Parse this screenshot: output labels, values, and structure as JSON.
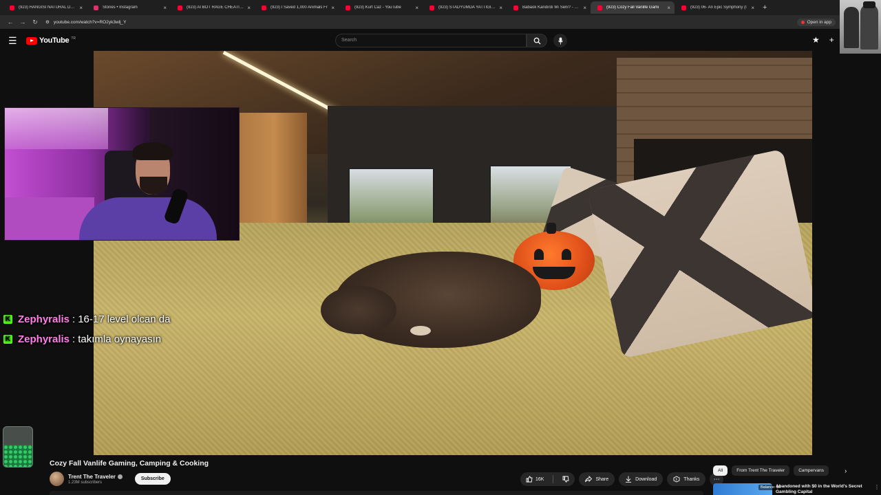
{
  "browser": {
    "tabs": [
      {
        "label": "(923) HANGİSİ NATURAL DEĞİ",
        "color": "#ff0033",
        "active": false
      },
      {
        "label": "Stories • Instagram",
        "color": "#e1306c",
        "active": false
      },
      {
        "label": "(923) AI BOT RAGE CHEATING",
        "color": "#ff0033",
        "active": false
      },
      {
        "label": "(923) I Saved 1,000 Animals Fr",
        "color": "#ff0033",
        "active": false
      },
      {
        "label": "(923) Kurt Caz - YouTube",
        "color": "#ff0033",
        "active": false
      },
      {
        "label": "(923) STADYUMDA YATTIĞIN Y",
        "color": "#ff0033",
        "active": false
      },
      {
        "label": "Babaok Kandırdı Mı Seni? - You",
        "color": "#ff0033",
        "active": false
      },
      {
        "label": "(923) Cozy Fall Vanlife Gami",
        "color": "#ff0033",
        "active": true
      },
      {
        "label": "(923) 06- An Epic Symphony (I",
        "color": "#ff0033",
        "active": false
      }
    ],
    "new_tab": "+",
    "url": "youtube.com/watch?v=RO2yk3wlj_Y",
    "open_in_app": "Open in app"
  },
  "youtube": {
    "logo_text": "YouTube",
    "logo_sup": "TR",
    "search_placeholder": "Search"
  },
  "chat": [
    {
      "user": "Zephyralis",
      "sep": ":",
      "message": "16-17 level olcan da"
    },
    {
      "user": "Zephyralis",
      "sep": ":",
      "message": "takımla oynayasın"
    }
  ],
  "video": {
    "title": "Cozy Fall Vanlife Gaming, Camping & Cooking",
    "channel": "Trent The Traveler",
    "subscribers": "1.23M subscribers",
    "subscribe": "Subscribe",
    "likes": "16K",
    "share": "Share",
    "download": "Download",
    "thanks": "Thanks"
  },
  "chips": [
    "All",
    "From Trent The Traveler",
    "Campervans"
  ],
  "recommendation": {
    "title": "Abandoned with $0 in the World's Secret Gambling Capital",
    "badge": "Balance: $0"
  },
  "colors": {
    "accent": "#ff0000",
    "kick": "#53fc18",
    "chat_user": "#ff7fe6"
  }
}
